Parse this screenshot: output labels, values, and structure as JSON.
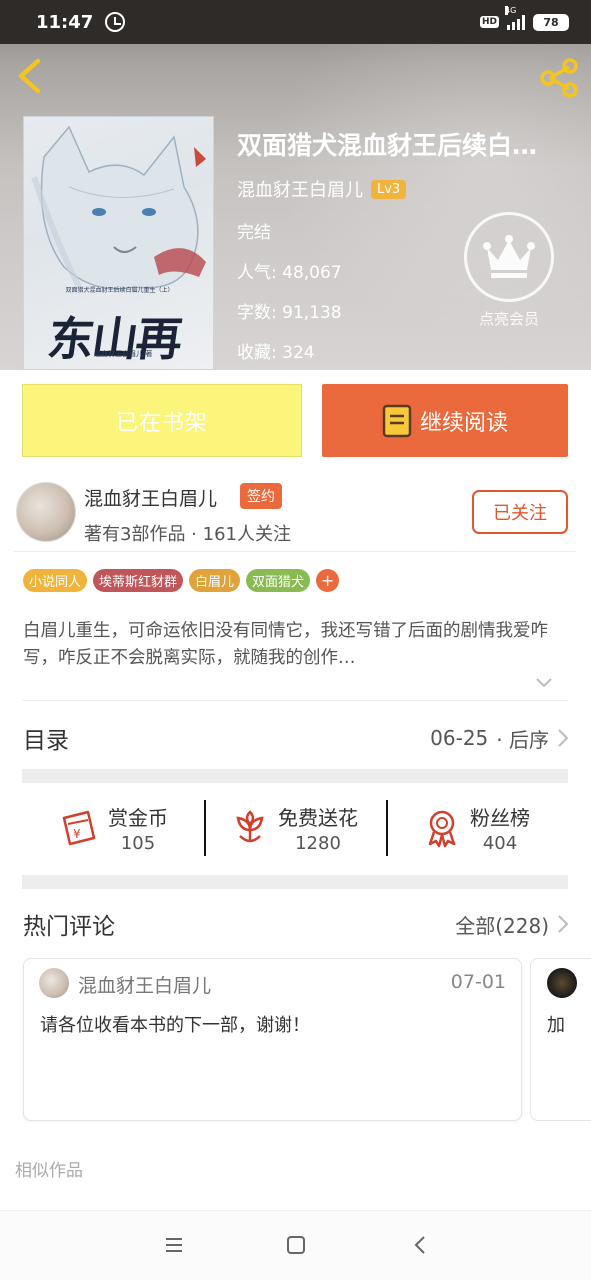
{
  "status_bar": {
    "time": "11:47",
    "hd": "HD",
    "network": "4G",
    "battery": "78"
  },
  "book": {
    "title": "双面猎犬混血豺王后续白…",
    "author": "混血豺王白眉儿",
    "level": "Lv3",
    "status": "完结",
    "popularity": "人气: 48,067",
    "word_count": "字数: 91,138",
    "favorites": "收藏: 324",
    "cover": {
      "subtitle": "双面猎犬混血豺王后续白眉儿重生（上）",
      "title": "东山再起",
      "author": "混血豺王白眉儿/著"
    }
  },
  "vip": {
    "label": "点亮会员"
  },
  "actions": {
    "shelf_label": "已在书架",
    "read_label": "继续阅读"
  },
  "author_card": {
    "name": "混血豺王白眉儿",
    "badge": "签约",
    "stats": "著有3部作品 · 161人关注",
    "follow_label": "已关注"
  },
  "tags": [
    {
      "label": "小说同人",
      "color": "#f0b43c"
    },
    {
      "label": "埃蒂斯红豺群",
      "color": "#c0565a"
    },
    {
      "label": "白眉儿",
      "color": "#e0a23a"
    },
    {
      "label": "双面猎犬",
      "color": "#8aba52"
    }
  ],
  "tag_more": "+",
  "description": "白眉儿重生，可命运依旧没有同情它，我还写错了后面的剧情我爱咋写，咋反正不会脱离实际，就随我的创作…",
  "toc": {
    "title": "目录",
    "date": "06-25",
    "sort": "· 后序"
  },
  "support": [
    {
      "label": "赏金币",
      "count": "105",
      "icon": "reward-coin-icon"
    },
    {
      "label": "免费送花",
      "count": "1280",
      "icon": "flower-icon"
    },
    {
      "label": "粉丝榜",
      "count": "404",
      "icon": "medal-icon"
    }
  ],
  "comments_section": {
    "title": "热门评论",
    "all_label": "全部(228)"
  },
  "comments": [
    {
      "user": "混血豺王白眉儿",
      "date": "07-01",
      "text": "请各位收看本书的下一部，谢谢！"
    },
    {
      "text": "加"
    }
  ],
  "similar": {
    "title": "相似作品"
  },
  "colors": {
    "accent": "#ea6a3e",
    "shelf_button": "#fbf57c",
    "lv_badge": "#f0b43c"
  }
}
